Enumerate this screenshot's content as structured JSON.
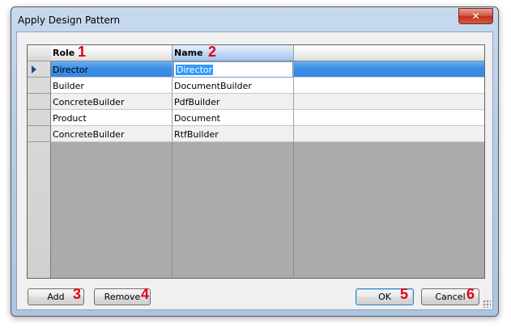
{
  "window": {
    "title": "Apply Design Pattern",
    "close_glyph": "✕"
  },
  "grid": {
    "columns": [
      {
        "label": "Role",
        "badge": "1"
      },
      {
        "label": "Name",
        "badge": "2"
      }
    ],
    "rows": [
      {
        "role": "Director",
        "name": "Director",
        "selected": true
      },
      {
        "role": "Builder",
        "name": "DocumentBuilder"
      },
      {
        "role": "ConcreteBuilder",
        "name": "PdfBuilder"
      },
      {
        "role": "Product",
        "name": "Document"
      },
      {
        "role": "ConcreteBuilder",
        "name": "RtfBuilder"
      }
    ]
  },
  "buttons": {
    "add": {
      "label": "Add",
      "badge": "3"
    },
    "remove": {
      "label": "Remove",
      "badge": "4"
    },
    "ok": {
      "label": "OK",
      "badge": "5"
    },
    "cancel": {
      "label": "Cancel",
      "badge": "6"
    }
  },
  "colors": {
    "selection": "#3388e4",
    "badge": "#e0001b",
    "close_button": "#c0301b"
  }
}
